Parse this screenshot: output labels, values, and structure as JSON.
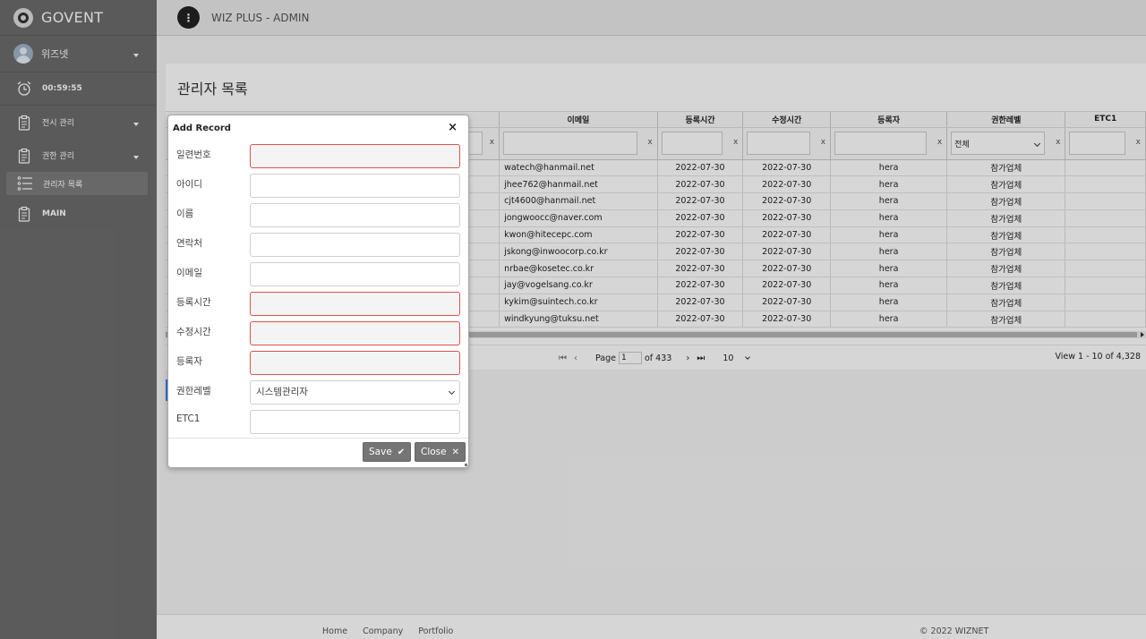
{
  "brand": {
    "name": "GOVENT"
  },
  "user": {
    "name": "위즈넷"
  },
  "timer": {
    "value": "00:59:55"
  },
  "menu": [
    {
      "label": "전시 관리",
      "has_caret": true
    },
    {
      "label": "권한 관리",
      "has_caret": true
    },
    {
      "label": "관리자 목록",
      "active": true
    },
    {
      "label": "MAIN"
    }
  ],
  "topbar": {
    "title": "WIZ PLUS - ADMIN",
    "menu_btn": "⋮"
  },
  "page": {
    "title": "관리자 목록"
  },
  "grid": {
    "columns": [
      "이메일",
      "등록시간",
      "수정시간",
      "등록자",
      "권한레벨",
      "ETC1"
    ],
    "filter_x": "x",
    "level_filter": "전체",
    "rows": [
      [
        "watech@hanmail.net",
        "2022-07-30",
        "2022-07-30",
        "hera",
        "참가업체",
        ""
      ],
      [
        "jhee762@hanmail.net",
        "2022-07-30",
        "2022-07-30",
        "hera",
        "참가업체",
        ""
      ],
      [
        "cjt4600@hanmail.net",
        "2022-07-30",
        "2022-07-30",
        "hera",
        "참가업체",
        ""
      ],
      [
        "jongwoocc@naver.com",
        "2022-07-30",
        "2022-07-30",
        "hera",
        "참가업체",
        ""
      ],
      [
        "kwon@hitecepc.com",
        "2022-07-30",
        "2022-07-30",
        "hera",
        "참가업체",
        ""
      ],
      [
        "jskong@inwoocorp.co.kr",
        "2022-07-30",
        "2022-07-30",
        "hera",
        "참가업체",
        ""
      ],
      [
        "nrbae@kosetec.co.kr",
        "2022-07-30",
        "2022-07-30",
        "hera",
        "참가업체",
        ""
      ],
      [
        "jay@vogelsang.co.kr",
        "2022-07-30",
        "2022-07-30",
        "hera",
        "참가업체",
        ""
      ],
      [
        "kykim@suintech.co.kr",
        "2022-07-30",
        "2022-07-30",
        "hera",
        "참가업체",
        ""
      ],
      [
        "windkyung@tuksu.net",
        "2022-07-30",
        "2022-07-30",
        "hera",
        "참가업체",
        ""
      ]
    ]
  },
  "pager": {
    "page_label": "Page",
    "page_value": "1",
    "of_label": "of 433",
    "page_size": "10",
    "view_text": "View 1 - 10 of 4,328"
  },
  "footer": {
    "links": [
      "Home",
      "Company",
      "Portfolio"
    ],
    "copyright": "© 2022 WIZNET"
  },
  "dialog": {
    "title": "Add Record",
    "close": "×",
    "fields": [
      {
        "label": "일련번호",
        "readonly": true
      },
      {
        "label": "아이디",
        "readonly": false
      },
      {
        "label": "이름",
        "readonly": false
      },
      {
        "label": "연락처",
        "readonly": false
      },
      {
        "label": "이메일",
        "readonly": false
      },
      {
        "label": "등록시간",
        "readonly": true
      },
      {
        "label": "수정시간",
        "readonly": true
      },
      {
        "label": "등록자",
        "readonly": true
      },
      {
        "label": "권한레벨",
        "select": true,
        "value": "시스템관리자"
      },
      {
        "label": "ETC1",
        "readonly": false
      }
    ],
    "save_label": "Save",
    "save_icon": "✔",
    "close_label": "Close",
    "close_icon": "✕"
  }
}
